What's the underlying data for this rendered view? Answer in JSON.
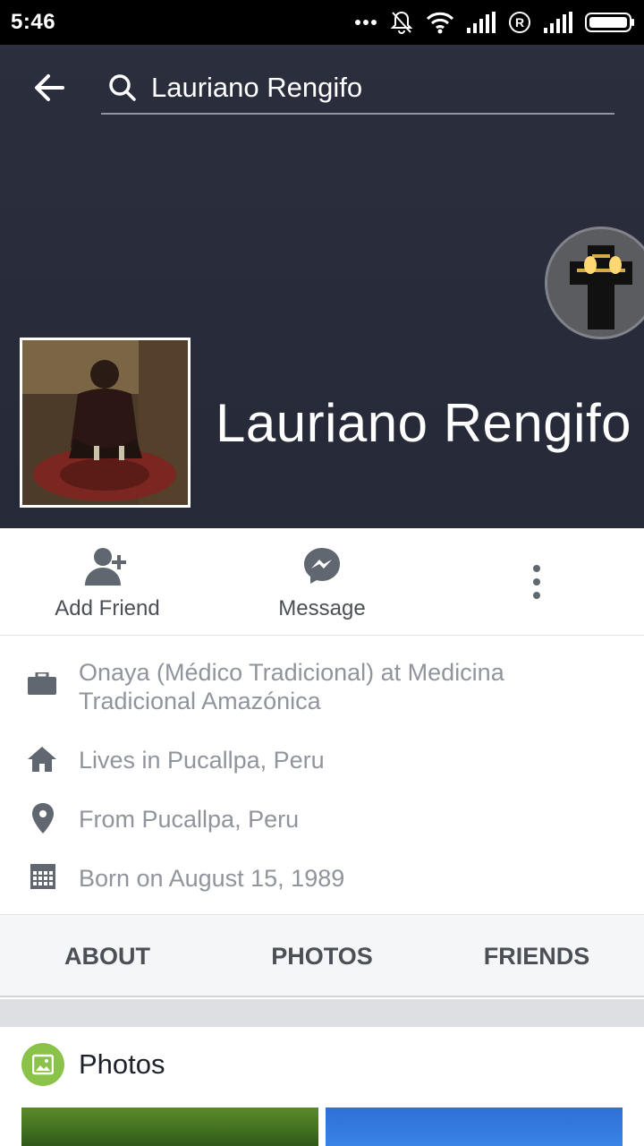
{
  "status_bar": {
    "time": "5:46",
    "icons": [
      "more-dots-icon",
      "bell-off-icon",
      "wifi-icon",
      "signal-icon",
      "roaming-icon",
      "signal-icon",
      "battery-icon"
    ]
  },
  "header": {
    "search_text": "Lauriano Rengifo"
  },
  "profile": {
    "name": "Lauriano Rengifo"
  },
  "actions": [
    {
      "label": "Add Friend",
      "icon": "add-friend-icon"
    },
    {
      "label": "Message",
      "icon": "messenger-icon"
    },
    {
      "label": "",
      "icon": "more-vertical-icon"
    }
  ],
  "intro": [
    {
      "icon": "briefcase-icon",
      "text": "Onaya (Médico Tradicional) at Medicina Tradicional Amazónica"
    },
    {
      "icon": "home-icon",
      "text": "Lives in Pucallpa, Peru"
    },
    {
      "icon": "location-pin-icon",
      "text": "From Pucallpa, Peru"
    },
    {
      "icon": "calendar-icon",
      "text": "Born on August 15, 1989"
    }
  ],
  "tabs": [
    "ABOUT",
    "PHOTOS",
    "FRIENDS"
  ],
  "photos_section": {
    "title": "Photos"
  },
  "colors": {
    "cover_bg": "#262a38",
    "text_secondary": "#90949c",
    "tab_text": "#4b4f56",
    "photos_badge": "#8bc34a"
  }
}
